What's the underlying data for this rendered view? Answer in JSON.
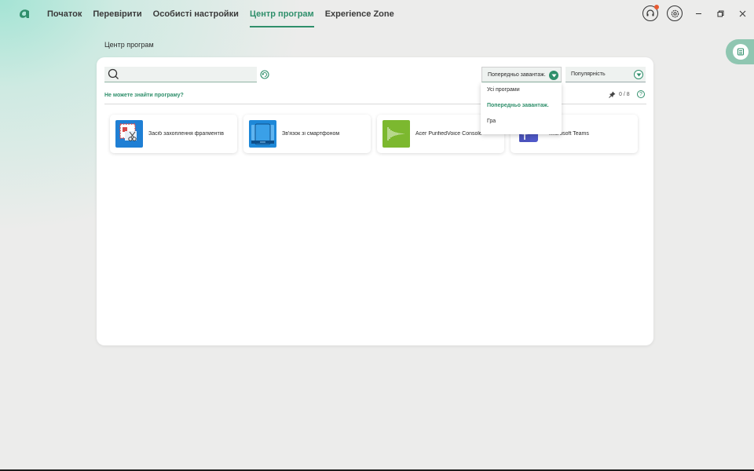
{
  "nav": {
    "items": [
      "Початок",
      "Перевірити",
      "Особисті настройки",
      "Центр програм",
      "Experience Zone"
    ],
    "active_index": 3
  },
  "page": {
    "title": "Центр програм"
  },
  "search": {
    "placeholder": ""
  },
  "help_link": "Не можете знайти програму?",
  "filters": {
    "source_selected": "Попередньо завантаж.",
    "sort_selected": "Популярність",
    "source_options": [
      "Усі програми",
      "Попередньо завантаж.",
      "Гра"
    ]
  },
  "pinned": {
    "text": "0 / 8"
  },
  "help_icon": "?",
  "apps": [
    {
      "name": "Засіб захоплення фрагментів",
      "icon": "snipping-tool-icon"
    },
    {
      "name": "Зв'язок зі смартфоном",
      "icon": "phone-link-icon"
    },
    {
      "name": "Acer PurifiedVoice Console",
      "icon": "purifiedvoice-icon"
    },
    {
      "name": "Microsoft Teams",
      "icon": "teams-icon"
    }
  ],
  "colors": {
    "accent": "#2f8f6b",
    "background": "#ececeb"
  }
}
